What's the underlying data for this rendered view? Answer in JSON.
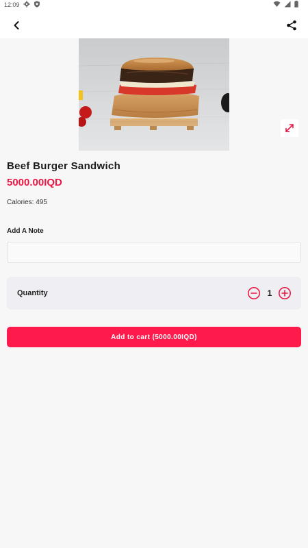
{
  "status_bar": {
    "time": "12:09",
    "icons": [
      "settings-icon",
      "shield-icon",
      "wifi-icon",
      "signal-icon",
      "battery-icon"
    ]
  },
  "app_bar": {
    "back_icon": "arrow-back-icon",
    "share_icon": "share-icon"
  },
  "product": {
    "image_icon": "burger-photo",
    "expand_icon": "expand-icon",
    "name": "Beef Burger Sandwich",
    "price": "5000.00IQD",
    "calories": "Calories: 495"
  },
  "note": {
    "label": "Add A Note",
    "value": "",
    "placeholder": ""
  },
  "quantity": {
    "label": "Quantity",
    "value": "1"
  },
  "cart": {
    "button_label": "Add to cart (5000.00IQD)"
  },
  "colors": {
    "accent": "#fe1a4b",
    "price": "#ea1845",
    "background": "#f7f7f8",
    "card": "#efeff3"
  }
}
